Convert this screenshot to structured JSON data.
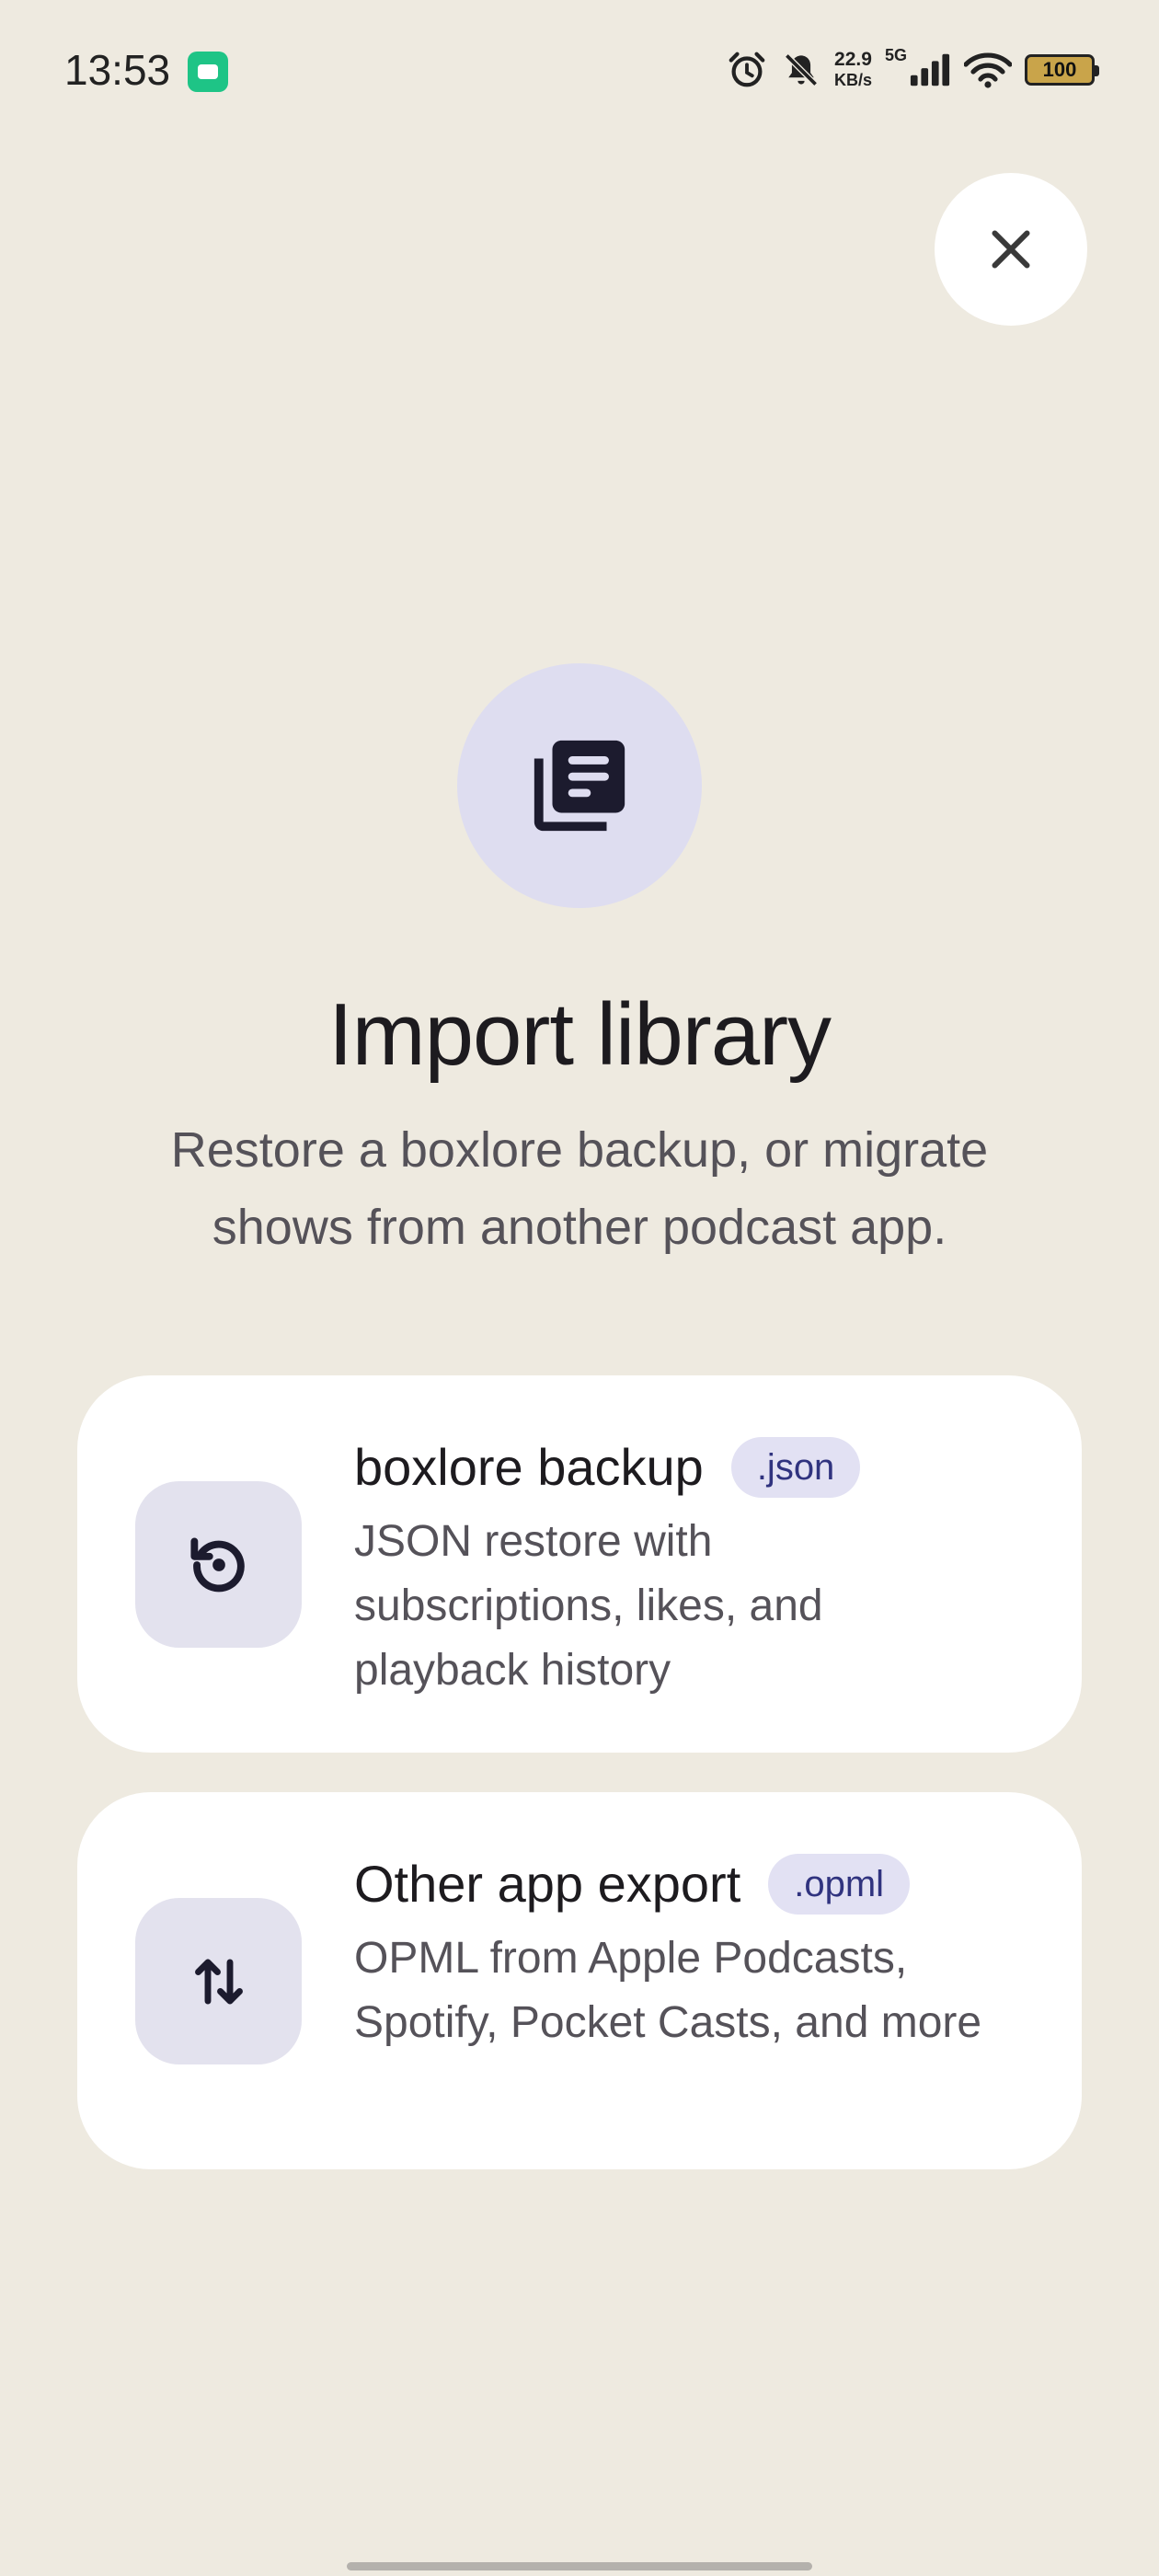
{
  "status_bar": {
    "time": "13:53",
    "net_speed_value": "22.9",
    "net_speed_unit": "KB/s",
    "network_type": "5G",
    "battery_level": "100",
    "app_notification_color": "#1EC486"
  },
  "header": {
    "close_icon": "close-icon"
  },
  "hero": {
    "icon": "library-icon",
    "title": "Import library",
    "subtitle": "Restore a boxlore backup, or migrate shows from another podcast app."
  },
  "options": [
    {
      "icon": "restore-icon",
      "title": "boxlore backup",
      "badge": ".json",
      "description": "JSON restore with subscriptions, likes, and playback history"
    },
    {
      "icon": "swap-vertical-icon",
      "title": "Other app export",
      "badge": ".opml",
      "description": "OPML from Apple Podcasts, Spotify, Pocket Casts, and more"
    }
  ],
  "colors": {
    "background": "#EEEAE0",
    "card": "#FFFFFF",
    "icon_tile": "#E3E2EE",
    "hero_circle": "#DEDDF0",
    "badge_bg": "#E2E1F3",
    "badge_text": "#30337F"
  }
}
